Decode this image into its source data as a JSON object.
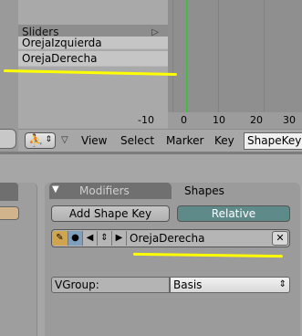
{
  "action_editor": {
    "channels": {
      "group": "Sliders",
      "items": [
        "OrejaIzquierda",
        "OrejaDerecha"
      ]
    },
    "ruler": {
      "ticks": [
        "-10",
        "0",
        "10",
        "20",
        "30"
      ]
    },
    "header": {
      "menus": [
        "View",
        "Select",
        "Marker",
        "Key"
      ],
      "mode": "ShapeKey"
    }
  },
  "buttons_window": {
    "tabs": [
      "Modifiers",
      "Shapes"
    ],
    "active_tab": "Shapes",
    "add_shape_key": "Add Shape Key",
    "relative": "Relative",
    "shape_key_name": "OrejaDerecha",
    "delete": "✕",
    "vgroup_label": "VGroup:",
    "basis": "Basis"
  },
  "colors": {
    "annotation": "#ffff00",
    "playhead": "#3fbf3f",
    "relative_active": "#5f8a8a"
  }
}
